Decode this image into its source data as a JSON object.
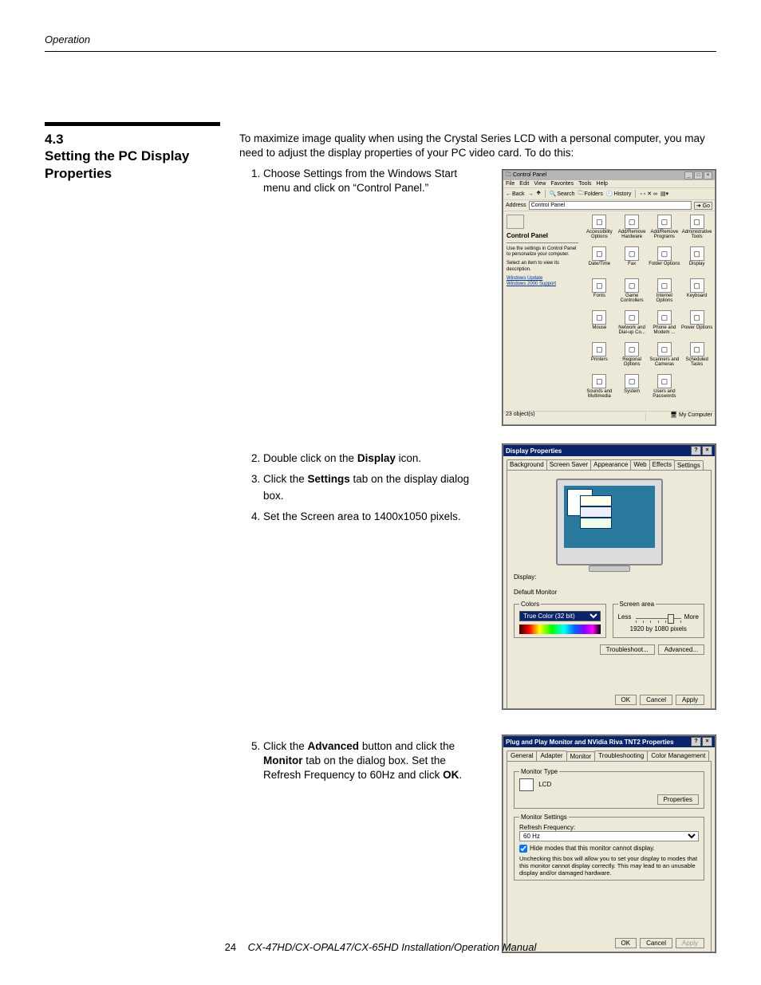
{
  "header": {
    "running": "Operation"
  },
  "sidehead": {
    "num": "4.3",
    "title": "Setting the PC Display Properties"
  },
  "intro": "To maximize image quality when using the Crystal Series LCD with a personal computer, you may need to adjust the display properties of your PC video card. To do this:",
  "step1": {
    "pre": "Choose Settings from the Windows Start menu and click on “Control Panel.”"
  },
  "step2": {
    "a": "Double click on the ",
    "a_bold": "Display",
    "a_post": " icon."
  },
  "step3": {
    "a": "Click the ",
    "a_bold": "Settings",
    "a_post": " tab on the display dialog box."
  },
  "step4": {
    "text": "Set the Screen area to 1400x1050 pixels."
  },
  "step5": {
    "a": "Click the ",
    "a_bold": "Advanced",
    "a_post": " button and click the ",
    "b_bold": "Monitor",
    "b_post": " tab on the dialog box. Set the Refresh Frequency to 60Hz and click ",
    "c_bold": "OK",
    "c_post": "."
  },
  "footer": {
    "page": "24",
    "title": "CX-47HD/CX-OPAL47/CX-65HD Installation/Operation Manual"
  },
  "shot1": {
    "title": "Control Panel",
    "menus": [
      "File",
      "Edit",
      "View",
      "Favorites",
      "Tools",
      "Help"
    ],
    "toolbar": {
      "back": "Back",
      "search": "Search",
      "folders": "Folders",
      "history": "History"
    },
    "addr_label": "Address",
    "addr_value": "Control Panel",
    "go": "Go",
    "left": {
      "title": "Control Panel",
      "desc": "Use the settings in Control Panel to personalize your computer.",
      "desc2": "Select an item to view its description.",
      "link1": "Windows Update",
      "link2": "Windows 2000 Support"
    },
    "icons": [
      "Accessibility Options",
      "Add/Remove Hardware",
      "Add/Remove Programs",
      "Administrative Tools",
      "Date/Time",
      "Fax",
      "Folder Options",
      "Display",
      "Fonts",
      "Game Controllers",
      "Internet Options",
      "Keyboard",
      "Mouse",
      "Network and Dial-up Co...",
      "Phone and Modem ...",
      "Power Options",
      "Printers",
      "Regional Options",
      "Scanners and Cameras",
      "Scheduled Tasks",
      "Sounds and Multimedia",
      "System",
      "Users and Passwords"
    ],
    "status_left": "23 object(s)",
    "status_right": "My Computer"
  },
  "shot2": {
    "title": "Display Properties",
    "tabs": [
      "Background",
      "Screen Saver",
      "Appearance",
      "Web",
      "Effects",
      "Settings"
    ],
    "active_tab": 5,
    "display_label": "Display:",
    "display_value": "Default Monitor",
    "colors_legend": "Colors",
    "colors_value": "True Color (32 bit)",
    "area_legend": "Screen area",
    "less": "Less",
    "more": "More",
    "resolution": "1920 by 1080 pixels",
    "troubleshoot": "Troubleshoot...",
    "advanced": "Advanced...",
    "ok": "OK",
    "cancel": "Cancel",
    "apply": "Apply"
  },
  "shot3": {
    "title": "Plug and Play Monitor and NVidia Riva TNT2 Properties",
    "tabs": [
      "General",
      "Adapter",
      "Monitor",
      "Troubleshooting",
      "Color Management"
    ],
    "active_tab": 2,
    "mtype_legend": "Monitor Type",
    "mtype_value": "LCD",
    "properties": "Properties",
    "msettings_legend": "Monitor Settings",
    "refresh_label": "Refresh Frequency:",
    "refresh_value": "60 Hz",
    "hide_label": "Hide modes that this monitor cannot display.",
    "hide_note": "Unchecking this box will allow you to set your display to modes that this monitor cannot display correctly. This may lead to an unusable display and/or damaged hardware.",
    "ok": "OK",
    "cancel": "Cancel",
    "apply": "Apply"
  }
}
